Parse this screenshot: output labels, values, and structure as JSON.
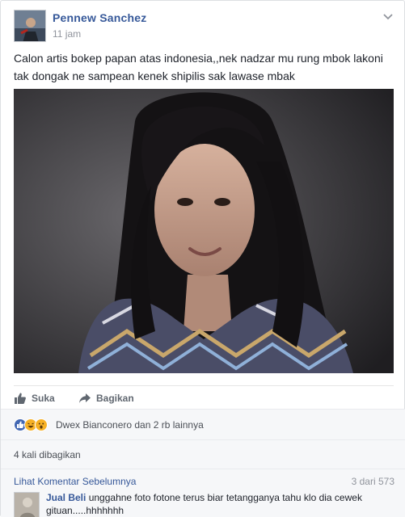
{
  "post": {
    "author": "Pennew Sanchez",
    "time": "11 jam",
    "text": "Calon artis bokep papan atas indonesia,,nek nadzar mu rung mbok lakoni tak dongak ne sampean kenek shipilis sak lawase mbak",
    "photo_icon": "photo-of-woman"
  },
  "actions": {
    "like_label": "Suka",
    "share_label": "Bagikan"
  },
  "reactions": {
    "icons": [
      "like-icon",
      "haha-icon",
      "wow-icon"
    ],
    "summary": "Dwex Bianconero dan 2 rb lainnya"
  },
  "shares": {
    "label": "4 kali dibagikan"
  },
  "comments": {
    "view_previous": "Lihat Komentar Sebelumnya",
    "count": "3 dari 573",
    "items": [
      {
        "author": "Jual Beli",
        "text": "unggahne foto fotone terus biar tetangganya tahu klo dia cewek gituan.....hhhhhhh"
      }
    ]
  },
  "colors": {
    "link": "#365899",
    "muted": "#90949c",
    "like_blue": "#4267b2",
    "haha_yellow": "#f7b125"
  }
}
